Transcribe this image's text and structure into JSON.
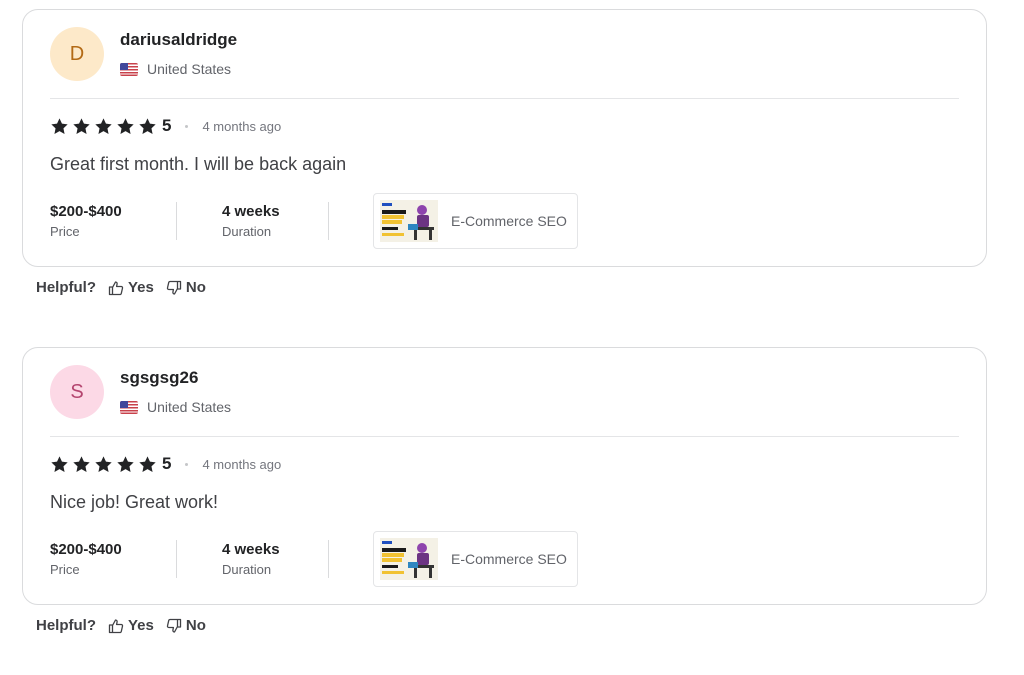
{
  "reviews": [
    {
      "avatar_letter": "D",
      "avatar_bg": "#fde9c9",
      "avatar_color": "#b36a15",
      "username": "dariusaldridge",
      "country": "United States",
      "rating": "5",
      "time_ago": "4 months ago",
      "text": "Great first month. I will be back again",
      "price_value": "$200-$400",
      "price_label": "Price",
      "duration_value": "4 weeks",
      "duration_label": "Duration",
      "gig_title": "E-Commerce SEO",
      "helpful_label": "Helpful?",
      "yes_label": "Yes",
      "no_label": "No"
    },
    {
      "avatar_letter": "S",
      "avatar_bg": "#fcd9e6",
      "avatar_color": "#b4456f",
      "username": "sgsgsg26",
      "country": "United States",
      "rating": "5",
      "time_ago": "4 months ago",
      "text": "Nice job! Great work!",
      "price_value": "$200-$400",
      "price_label": "Price",
      "duration_value": "4 weeks",
      "duration_label": "Duration",
      "gig_title": "E-Commerce SEO",
      "helpful_label": "Helpful?",
      "yes_label": "Yes",
      "no_label": "No"
    }
  ],
  "icons": {
    "star": "star-icon",
    "flag": "us-flag-icon",
    "thumbs_up": "thumbs-up-icon",
    "thumbs_down": "thumbs-down-icon"
  },
  "colors": {
    "star": "#222325",
    "text": "#222325",
    "muted": "#62646a",
    "border": "#dadbdd"
  }
}
